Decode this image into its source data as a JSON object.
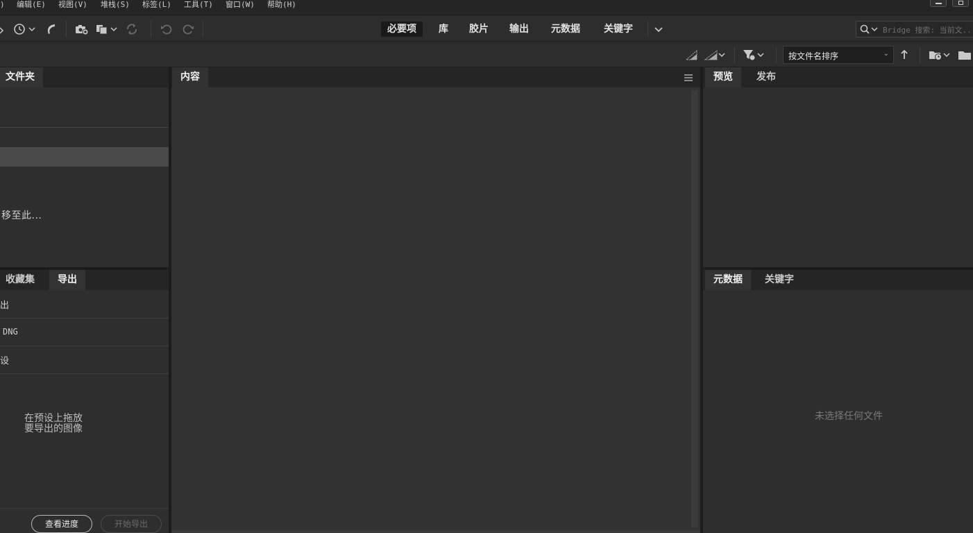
{
  "menu": {
    "items": [
      ")",
      "编辑(E)",
      "视图(V)",
      "堆栈(S)",
      "标签(L)",
      "工具(T)",
      "窗口(W)",
      "帮助(H)"
    ]
  },
  "toolbar": {
    "icons": [
      "history-icon",
      "boomerang-icon",
      "camera-import-icon",
      "copy-stack-icon",
      "refresh-icon",
      "rotate-left-icon",
      "rotate-right-icon"
    ]
  },
  "workspaces": {
    "items": [
      "必要项",
      "库",
      "胶片",
      "输出",
      "元数据",
      "关键字"
    ],
    "active": "必要项"
  },
  "search": {
    "placeholder": "Bridge 搜索: 当前文..."
  },
  "sort": {
    "label": "按文件名排序"
  },
  "folders_panel": {
    "tab": "文件夹",
    "drop_hint": "移至此..."
  },
  "export_panel": {
    "tabs": [
      "收藏集",
      "导出"
    ],
    "active_tab": "导出",
    "rows": [
      "出",
      "DNG",
      "设"
    ],
    "hint_line1": "在预设上拖放",
    "hint_line2": "要导出的图像",
    "view_progress": "查看进度",
    "start_export": "开始导出"
  },
  "content_panel": {
    "tab": "内容"
  },
  "preview_panel": {
    "tabs": [
      "预览",
      "发布"
    ],
    "active_tab": "预览"
  },
  "metadata_panel": {
    "tabs": [
      "元数据",
      "关键字"
    ],
    "active_tab": "元数据",
    "empty_text": "未选择任何文件"
  },
  "colors": {
    "background": "#2b2b2b",
    "panel": "#2e2e2e",
    "tabbar": "#252525",
    "selection": "#4a4a4a"
  }
}
